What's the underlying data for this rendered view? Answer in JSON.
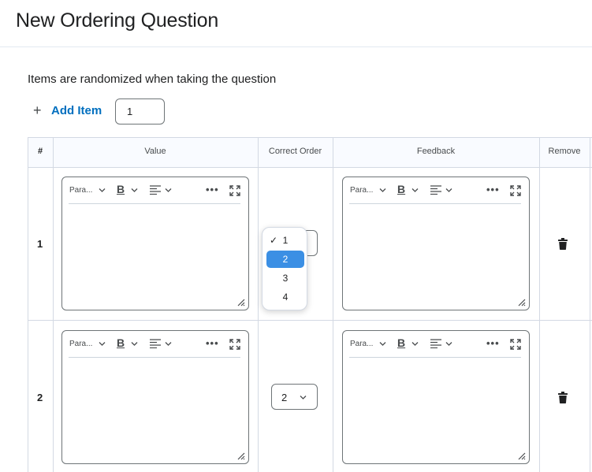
{
  "page": {
    "title": "New Ordering Question"
  },
  "instructions": "Items are randomized when taking the question",
  "add_item": {
    "icon": "plus-icon",
    "label": "Add Item",
    "count_value": "1"
  },
  "table": {
    "headers": {
      "num": "#",
      "value": "Value",
      "correct_order": "Correct Order",
      "feedback": "Feedback",
      "remove": "Remove"
    },
    "rows": [
      {
        "num": "1",
        "correct_order": "1"
      },
      {
        "num": "2",
        "correct_order": "2"
      }
    ]
  },
  "editor_toolbar": {
    "paragraph_label": "Para...",
    "bold_label": "B",
    "more_label": "•••"
  },
  "order_dropdown": {
    "options": [
      "1",
      "2",
      "3",
      "4"
    ],
    "checked": "1",
    "highlighted": "2",
    "check_mark": "✓"
  },
  "colors": {
    "link": "#006fbf",
    "highlight": "#3b8fe4",
    "border": "#6e7477",
    "gridline": "#d3d9e3"
  }
}
